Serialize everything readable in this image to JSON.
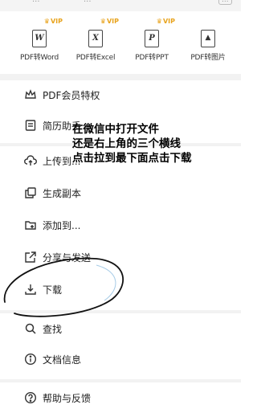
{
  "top_strip": {
    "text_left": "...",
    "text_mid": "...",
    "tag": "..."
  },
  "conversions": [
    {
      "label": "PDF转Word",
      "icon": "W",
      "vip": "VIP",
      "icon_name": "word-doc-icon"
    },
    {
      "label": "PDF转Excel",
      "icon": "X",
      "vip": "VIP",
      "icon_name": "excel-doc-icon"
    },
    {
      "label": "PDF转PPT",
      "icon": "P",
      "vip": "VIP",
      "icon_name": "ppt-doc-icon"
    },
    {
      "label": "PDF转图片",
      "icon": "▲",
      "vip": "",
      "icon_name": "image-doc-icon"
    }
  ],
  "menu": {
    "pdf_vip": "PDF会员特权",
    "resume": "简历助手",
    "upload": "上传到...",
    "copy": "生成副本",
    "add_to": "添加到...",
    "share": "分享与发送",
    "download": "下载",
    "find": "查找",
    "doc_info": "文档信息",
    "help": "帮助与反馈"
  },
  "annotation": {
    "line1": "在微信中打开文件",
    "line2": "还是右上角的三个横线",
    "line3": "点击拉到最下面点击下载"
  },
  "colors": {
    "vip": "#e8a31c",
    "separator": "#f2f2f2",
    "annotation_circle": "#000000"
  }
}
